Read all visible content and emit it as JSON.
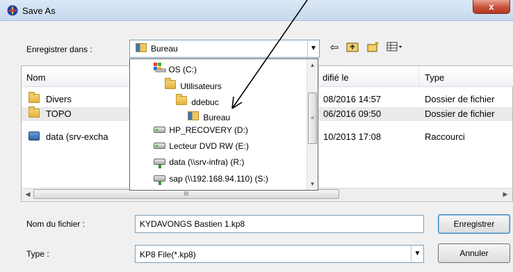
{
  "window": {
    "title": "Save As",
    "close_glyph": "x"
  },
  "toolbar": {
    "save_in_label": "Enregistrer dans :",
    "save_in_value": "Bureau",
    "icons": [
      "back-arrow-icon",
      "up-folder-icon",
      "new-folder-icon",
      "view-menu-icon"
    ]
  },
  "list": {
    "columns": [
      "Nom",
      "difié le",
      "Type"
    ],
    "rows": [
      {
        "name": "Divers",
        "date": "08/2016 14:57",
        "type": "Dossier de fichier"
      },
      {
        "name": "TOPO",
        "date": "06/2016 09:50",
        "type": "Dossier de fichier"
      },
      {
        "name": "data (srv-excha",
        "date": "10/2013 17:08",
        "type": "Raccourci"
      }
    ]
  },
  "dropdown": {
    "items": [
      {
        "label": "OS (C:)",
        "icon": "windows-drive-icon"
      },
      {
        "label": "Utilisateurs",
        "icon": "folder-icon"
      },
      {
        "label": "ddebuc",
        "icon": "folder-icon"
      },
      {
        "label": "Bureau",
        "icon": "desktop-folder-icon"
      },
      {
        "label": "HP_RECOVERY (D:)",
        "icon": "drive-icon"
      },
      {
        "label": "Lecteur DVD RW (E:)",
        "icon": "dvd-drive-icon"
      },
      {
        "label": "data (\\\\srv-infra) (R:)",
        "icon": "network-drive-icon"
      },
      {
        "label": "sap (\\\\192.168.94.110) (S:)",
        "icon": "network-drive-icon"
      }
    ]
  },
  "form": {
    "filename_label": "Nom du fichier :",
    "filename_value": "KYDAVONGS Bastien 1.kp8",
    "type_label": "Type :",
    "type_value": "KP8 File(*.kp8)",
    "save_button": "Enregistrer",
    "cancel_button": "Annuler"
  },
  "annotation": {
    "arrow_color": "#000000"
  }
}
